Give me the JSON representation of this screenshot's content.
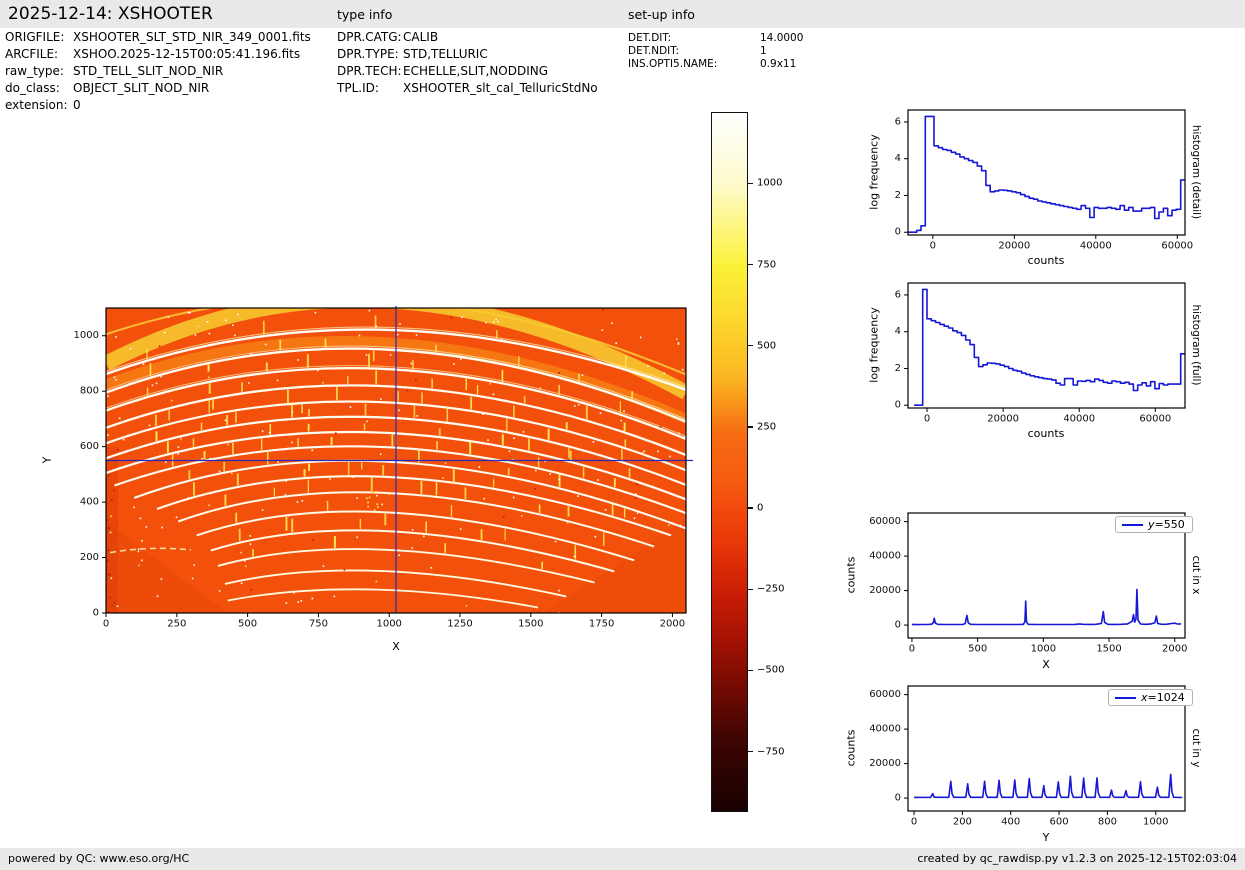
{
  "header": {
    "title": "2025-12-14: XSHOOTER",
    "type_info_label": "type info",
    "setup_info_label": "set-up info"
  },
  "file_info": {
    "rows": [
      {
        "label": "ORIGFILE:",
        "value": "XSHOOTER_SLT_STD_NIR_349_0001.fits"
      },
      {
        "label": "ARCFILE:",
        "value": "XSHOO.2025-12-15T00:05:41.196.fits"
      },
      {
        "label": "raw_type:",
        "value": "STD_TELL_SLIT_NOD_NIR"
      },
      {
        "label": "do_class:",
        "value": "OBJECT_SLIT_NOD_NIR"
      },
      {
        "label": "extension:",
        "value": "0"
      }
    ]
  },
  "type_info": {
    "rows": [
      {
        "label": "DPR.CATG:",
        "value": "CALIB"
      },
      {
        "label": "DPR.TYPE:",
        "value": "STD,TELLURIC"
      },
      {
        "label": "DPR.TECH:",
        "value": "ECHELLE,SLIT,NODDING"
      },
      {
        "label": "TPL.ID:",
        "value": "XSHOOTER_slt_cal_TelluricStdNo"
      }
    ]
  },
  "setup_info": {
    "rows": [
      {
        "label": "DET.DIT:",
        "value": "14.0000"
      },
      {
        "label": "DET.NDIT:",
        "value": "1"
      },
      {
        "label": "INS.OPTI5.NAME:",
        "value": "0.9x11"
      }
    ]
  },
  "footer": {
    "left": "powered by QC: www.eso.org/HC",
    "right": "created by qc_rawdisp.py v1.2.3 on 2025-12-15T02:03:04"
  },
  "colors": {
    "line_blue": "#1717d6",
    "crosshair_blue": "#2828c0",
    "image_background": "#f3510b",
    "order_tick_yellow": "#ffec55",
    "bar_gray": "#e9e9e9"
  },
  "chart_data": [
    {
      "id": "main",
      "type": "heatmap",
      "name": "raw echelle frame",
      "xlabel": "X",
      "ylabel": "Y",
      "xlim": [
        0,
        2048
      ],
      "ylim": [
        0,
        1100
      ],
      "xticks": [
        0,
        250,
        500,
        750,
        1000,
        1250,
        1500,
        1750,
        2000
      ],
      "yticks": [
        0,
        200,
        400,
        600,
        800,
        1000
      ],
      "colormap": "hot",
      "crosshair": {
        "x": 1024,
        "y": 550
      },
      "orders": [
        [
          0,
          1005,
          950,
          1330,
          2048,
          860,
          2,
          "#ffdf3f",
          0.75,
          0
        ],
        [
          0,
          900,
          950,
          1405,
          2048,
          795,
          15,
          "#f6cd30",
          0.85,
          0
        ],
        [
          0,
          825,
          955,
          1190,
          2048,
          700,
          10,
          "#f8951a",
          0.55,
          0
        ],
        [
          0,
          871,
          960,
          1218,
          2048,
          814,
          1.2,
          "#ffeeb0",
          0.7,
          0
        ],
        [
          0,
          862,
          960,
          1209,
          2048,
          805,
          2.4,
          "#fffef5",
          1,
          5
        ],
        [
          0,
          804,
          958,
          1167,
          2048,
          699,
          1.1,
          "#ffeeb0",
          0.7,
          0
        ],
        [
          0,
          795,
          958,
          1158,
          2048,
          690,
          2.4,
          "#fffdf0",
          1,
          9
        ],
        [
          0,
          739,
          955,
          1090,
          2048,
          637,
          1.1,
          "#ffeeb0",
          0.65,
          0
        ],
        [
          0,
          730,
          955,
          1081,
          2048,
          628,
          2.3,
          "#fffdf0",
          1,
          10
        ],
        [
          0,
          668,
          952,
          1017,
          2048,
          570,
          2.3,
          "#fffcee",
          1,
          11
        ],
        [
          0,
          612,
          950,
          956,
          2048,
          515,
          2.2,
          "#fffcee",
          1,
          11
        ],
        [
          0,
          558,
          948,
          900,
          2048,
          462,
          2.2,
          "#fffdf2",
          1,
          12
        ],
        [
          0,
          505,
          945,
          842,
          2048,
          410,
          2.2,
          "#fffdf2",
          1,
          12
        ],
        [
          30,
          460,
          944,
          786,
          2048,
          360,
          2.1,
          "#fffcf0",
          1,
          11
        ],
        [
          100,
          415,
          940,
          730,
          2048,
          305,
          2.1,
          "#fffcf0",
          1,
          10
        ],
        [
          180,
          375,
          935,
          652,
          1995,
          280,
          2.1,
          "#fffbea",
          1,
          9
        ],
        [
          255,
          330,
          930,
          579,
          1935,
          240,
          2,
          "#fffbea",
          1,
          8
        ],
        [
          320,
          280,
          925,
          489,
          1865,
          190,
          2,
          "#fffae6",
          1,
          7
        ],
        [
          370,
          225,
          920,
          402,
          1795,
          150,
          2,
          "#fffae6",
          1,
          6
        ],
        [
          395,
          170,
          915,
          316,
          1725,
          110,
          1.9,
          "#fff9e0",
          1,
          4
        ],
        [
          420,
          105,
          910,
          221,
          1625,
          60,
          1.9,
          "#fff9e0",
          1,
          0
        ],
        [
          430,
          45,
          905,
          137,
          1525,
          20,
          1.8,
          "#fff8dc",
          1,
          0
        ]
      ],
      "dashed_arc": [
        15,
        218,
        150,
        242,
        300,
        228
      ]
    },
    {
      "id": "colorbar",
      "type": "colorbar",
      "colormap": "hot",
      "vmin": -930,
      "vmax": 1220,
      "ticks": [
        1000,
        750,
        500,
        250,
        0,
        -250,
        -500,
        -750
      ]
    },
    {
      "id": "hist_detail",
      "type": "step",
      "right_label": "histogram (detail)",
      "xlabel": "counts",
      "ylabel": "log frequency",
      "xlim": [
        -6100,
        61900
      ],
      "ylim": [
        -0.15,
        6.65
      ],
      "xticks": [
        0,
        20000,
        40000,
        60000
      ],
      "yticks": [
        0,
        2,
        4,
        6
      ],
      "bin_start": -6100,
      "bin_width": 1062.5,
      "values": [
        0,
        0,
        0.1,
        0.35,
        6.3,
        6.3,
        4.7,
        4.6,
        4.5,
        4.45,
        4.35,
        4.25,
        4.1,
        4.0,
        3.9,
        3.8,
        3.6,
        3.35,
        2.55,
        2.2,
        2.25,
        2.3,
        2.28,
        2.25,
        2.2,
        2.15,
        2.05,
        1.95,
        1.85,
        1.8,
        1.7,
        1.65,
        1.6,
        1.55,
        1.5,
        1.45,
        1.4,
        1.35,
        1.3,
        1.25,
        1.45,
        1.3,
        0.8,
        1.35,
        1.3,
        1.3,
        1.35,
        1.3,
        1.25,
        1.45,
        1.2,
        1.35,
        1.15,
        1.15,
        1.3,
        1.3,
        1.35,
        0.75,
        1.1,
        1.3,
        0.9,
        1.2,
        1.25,
        2.85
      ]
    },
    {
      "id": "hist_full",
      "type": "step",
      "right_label": "histogram (full)",
      "xlabel": "counts",
      "ylabel": "log frequency",
      "xlim": [
        -5000,
        67800
      ],
      "ylim": [
        -0.15,
        6.65
      ],
      "xticks": [
        0,
        20000,
        40000,
        60000
      ],
      "yticks": [
        0,
        2,
        4,
        6
      ],
      "bin_start": -3400,
      "bin_width": 1130,
      "values": [
        0,
        0,
        6.3,
        4.7,
        4.6,
        4.5,
        4.4,
        4.3,
        4.2,
        4.05,
        3.95,
        3.8,
        3.55,
        3.3,
        2.6,
        2.1,
        2.2,
        2.3,
        2.28,
        2.25,
        2.18,
        2.1,
        2.0,
        1.9,
        1.85,
        1.75,
        1.68,
        1.6,
        1.55,
        1.5,
        1.45,
        1.42,
        1.38,
        1.2,
        1.1,
        1.45,
        1.45,
        1.1,
        1.32,
        1.3,
        1.35,
        1.28,
        1.42,
        1.35,
        1.25,
        1.2,
        1.32,
        1.28,
        1.2,
        1.25,
        1.15,
        0.8,
        1.1,
        1.22,
        1.05,
        1.28,
        0.9,
        1.18,
        1.1,
        1.15,
        1.15,
        1.15,
        2.8
      ]
    },
    {
      "id": "cut_x",
      "type": "line",
      "legend_var": "y",
      "legend_rest": "=550",
      "right_label": "cut in x",
      "xlabel": "X",
      "ylabel": "counts",
      "xlim": [
        -30,
        2078
      ],
      "ylim": [
        -7500,
        65000
      ],
      "xticks": [
        0,
        500,
        1000,
        1500,
        2000
      ],
      "yticks": [
        0,
        20000,
        40000,
        60000
      ],
      "points": [
        [
          0,
          400
        ],
        [
          40,
          300
        ],
        [
          80,
          350
        ],
        [
          120,
          320
        ],
        [
          150,
          500
        ],
        [
          163,
          1500
        ],
        [
          170,
          3900
        ],
        [
          178,
          1200
        ],
        [
          195,
          450
        ],
        [
          240,
          320
        ],
        [
          290,
          340
        ],
        [
          340,
          310
        ],
        [
          390,
          380
        ],
        [
          405,
          900
        ],
        [
          418,
          5600
        ],
        [
          428,
          1400
        ],
        [
          445,
          420
        ],
        [
          500,
          330
        ],
        [
          560,
          340
        ],
        [
          620,
          310
        ],
        [
          680,
          330
        ],
        [
          740,
          320
        ],
        [
          800,
          340
        ],
        [
          848,
          420
        ],
        [
          860,
          2000
        ],
        [
          866,
          13900
        ],
        [
          872,
          1800
        ],
        [
          885,
          420
        ],
        [
          940,
          330
        ],
        [
          1000,
          320
        ],
        [
          1060,
          340
        ],
        [
          1120,
          310
        ],
        [
          1180,
          330
        ],
        [
          1240,
          380
        ],
        [
          1275,
          700
        ],
        [
          1300,
          420
        ],
        [
          1350,
          360
        ],
        [
          1400,
          420
        ],
        [
          1442,
          900
        ],
        [
          1456,
          7800
        ],
        [
          1466,
          1600
        ],
        [
          1490,
          450
        ],
        [
          1540,
          380
        ],
        [
          1590,
          420
        ],
        [
          1640,
          700
        ],
        [
          1676,
          2200
        ],
        [
          1686,
          6100
        ],
        [
          1695,
          1700
        ],
        [
          1705,
          3500
        ],
        [
          1712,
          20700
        ],
        [
          1720,
          2800
        ],
        [
          1740,
          600
        ],
        [
          1780,
          450
        ],
        [
          1820,
          700
        ],
        [
          1848,
          1400
        ],
        [
          1860,
          5200
        ],
        [
          1870,
          900
        ],
        [
          1900,
          450
        ],
        [
          1940,
          480
        ],
        [
          1975,
          900
        ],
        [
          2000,
          1100
        ],
        [
          2020,
          600
        ],
        [
          2048,
          700
        ]
      ]
    },
    {
      "id": "cut_y",
      "type": "spikes",
      "legend_var": "x",
      "legend_rest": "=1024",
      "right_label": "cut in y",
      "xlabel": "Y",
      "ylabel": "counts",
      "xlim": [
        -25,
        1121
      ],
      "ylim": [
        -7500,
        65000
      ],
      "xticks": [
        0,
        200,
        400,
        600,
        800,
        1000
      ],
      "yticks": [
        0,
        20000,
        40000,
        60000
      ],
      "baseline": 320,
      "peaks": [
        [
          80,
          2600
        ],
        [
          155,
          9700
        ],
        [
          225,
          8300
        ],
        [
          295,
          9700
        ],
        [
          355,
          10300
        ],
        [
          420,
          10500
        ],
        [
          480,
          11300
        ],
        [
          540,
          7200
        ],
        [
          600,
          9400
        ],
        [
          650,
          12600
        ],
        [
          705,
          11600
        ],
        [
          760,
          11700
        ],
        [
          820,
          4600
        ],
        [
          880,
          4300
        ],
        [
          940,
          9500
        ],
        [
          1010,
          6300
        ],
        [
          1065,
          13700
        ]
      ],
      "end_x": 1110
    }
  ]
}
